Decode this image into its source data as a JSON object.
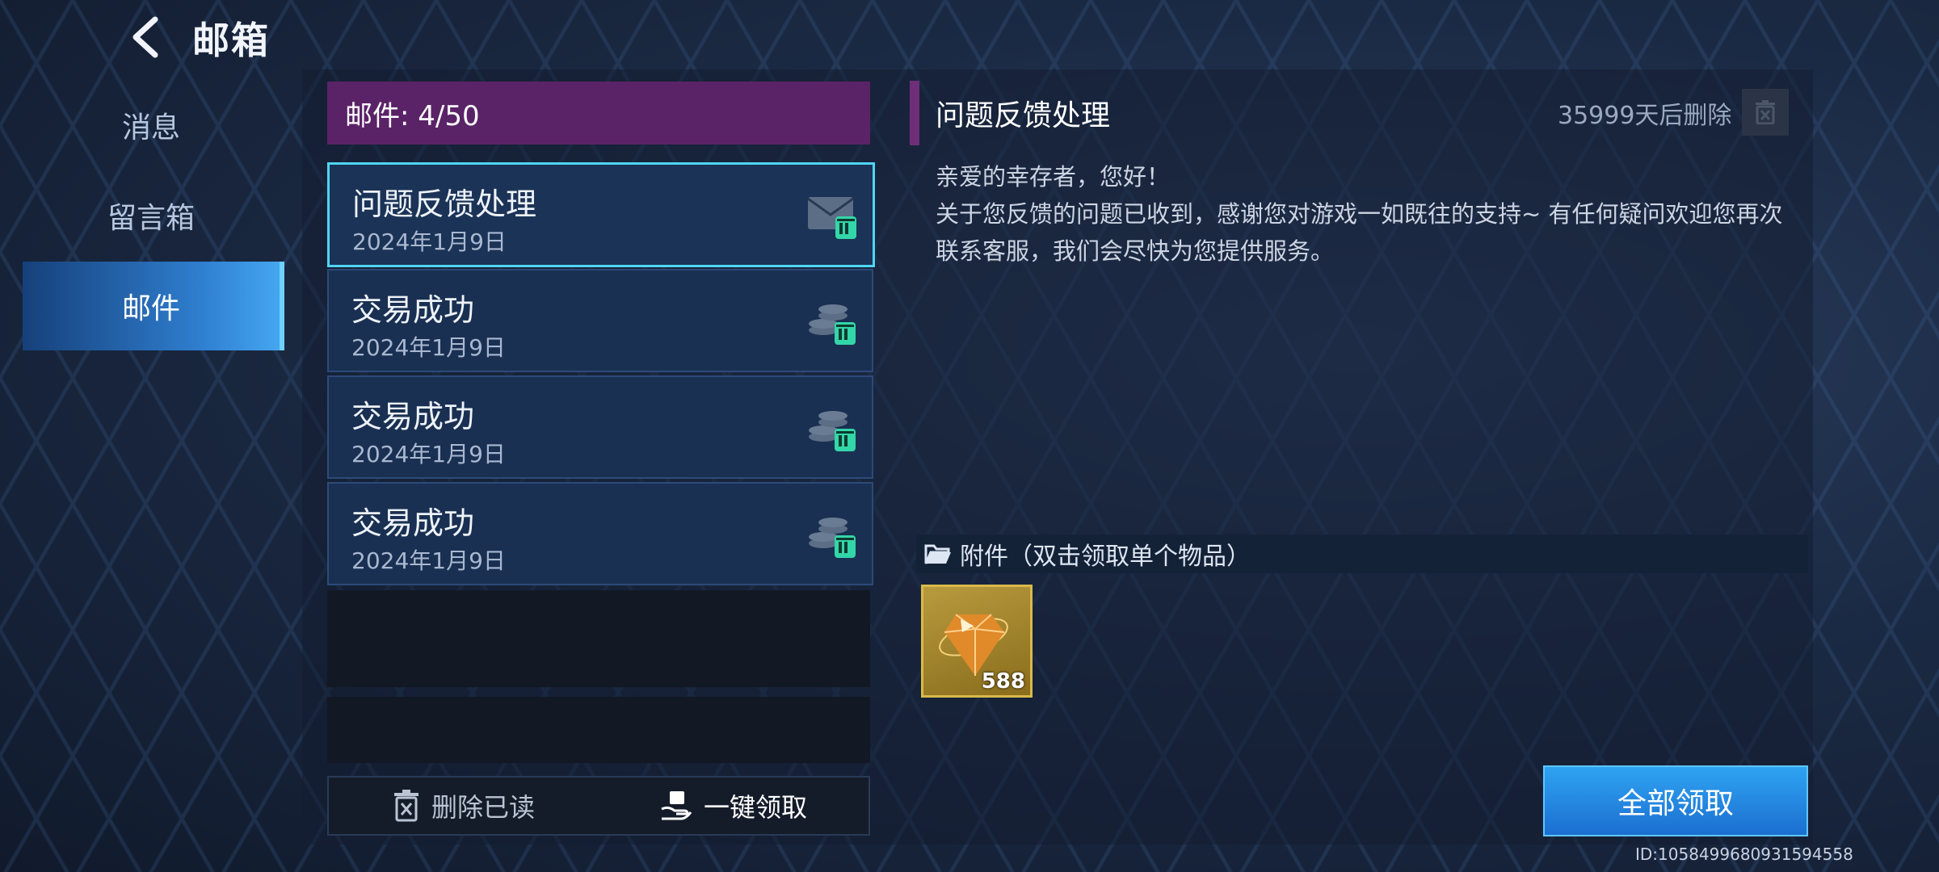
{
  "header": {
    "title": "邮箱",
    "back_icon": "chevron-left-icon"
  },
  "sidebar": {
    "items": [
      {
        "label": "消息",
        "active": false
      },
      {
        "label": "留言箱",
        "active": false
      },
      {
        "label": "邮件",
        "active": true
      }
    ]
  },
  "mail_list": {
    "count_label": "邮件: 4/50",
    "items": [
      {
        "title": "问题反馈处理",
        "date": "2024年1月9日",
        "icon": "envelope-icon",
        "selected": true
      },
      {
        "title": "交易成功",
        "date": "2024年1月9日",
        "icon": "coins-icon",
        "selected": false
      },
      {
        "title": "交易成功",
        "date": "2024年1月9日",
        "icon": "coins-icon",
        "selected": false
      },
      {
        "title": "交易成功",
        "date": "2024年1月9日",
        "icon": "coins-icon",
        "selected": false
      }
    ],
    "delete_read_label": "删除已读",
    "claim_one_click_label": "一键领取"
  },
  "detail": {
    "title": "问题反馈处理",
    "expire_text": "35999天后删除",
    "body_lines": [
      "亲爱的幸存者，您好！",
      "关于您反馈的问题已收到，感谢您对游戏一如既往的支持~ 有任何疑问欢迎您再次联系客服，我们会尽快为您提供服务。"
    ],
    "attachment_label": "附件（双击领取单个物品）",
    "attachment_item": {
      "icon": "gem-icon",
      "quantity": "588"
    },
    "claim_all_label": "全部领取"
  },
  "footer": {
    "uid": "ID:1058499680931594558"
  },
  "colors": {
    "accent_purple": "#5a2367",
    "accent_cyan": "#4fd6f2",
    "claim_blue": "#2fa3f2",
    "badge_green": "#33d6a8"
  }
}
